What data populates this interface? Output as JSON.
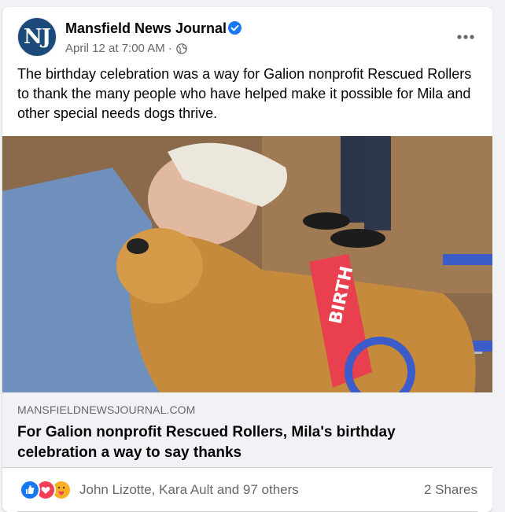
{
  "post": {
    "page_name": "Mansfield News Journal",
    "avatar_text": "NJ",
    "timestamp": "April 12 at 7:00 AM",
    "separator": "·",
    "text": "The birthday celebration was a way for Galion nonprofit Rescued Rollers to thank the many people who have helped make it possible for Mila and other special needs dogs thrive."
  },
  "link": {
    "domain": "MANSFIELDNEWSJOURNAL.COM",
    "headline": "For Galion nonprofit Rescued Rollers, Mila's birthday celebration a way to say thanks"
  },
  "photo": {
    "banner_text": "BIRTH"
  },
  "engagement": {
    "reactions": [
      "like",
      "love",
      "care"
    ],
    "names": "John Lizotte, Kara Ault and 97 others",
    "shares": "2 Shares"
  },
  "colors": {
    "brand_blue": "#1877f2",
    "avatar_bg": "#1c4a7a",
    "love_red": "#f33e58",
    "care_yellow": "#f7b125"
  },
  "icons": {
    "verified": "verified-badge-icon",
    "audience": "globe-icon",
    "more": "more-options-icon"
  }
}
